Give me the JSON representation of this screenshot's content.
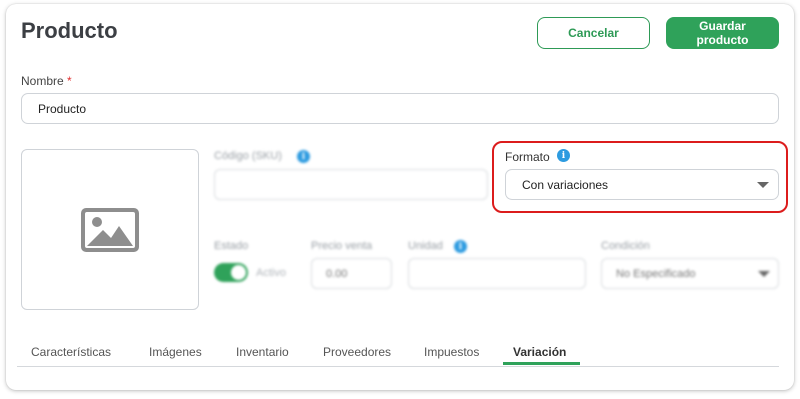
{
  "header": {
    "title": "Producto",
    "cancel_label": "Cancelar",
    "save_label": "Guardar producto"
  },
  "nombre": {
    "label": "Nombre",
    "required_mark": "*",
    "value": "Producto"
  },
  "sku": {
    "label": "Código (SKU)",
    "value": ""
  },
  "formato": {
    "label": "Formato",
    "value": "Con variaciones"
  },
  "estado": {
    "label": "Estado",
    "value": "Activo",
    "enabled": true
  },
  "precio": {
    "label": "Precio venta",
    "value": "0.00"
  },
  "unidad": {
    "label": "Unidad",
    "value": ""
  },
  "condicion": {
    "label": "Condición",
    "value": "No Especificado"
  },
  "tabs": [
    {
      "label": "Características"
    },
    {
      "label": "Imágenes"
    },
    {
      "label": "Inventario"
    },
    {
      "label": "Proveedores"
    },
    {
      "label": "Impuestos"
    },
    {
      "label": "Variación",
      "active": true
    }
  ],
  "colors": {
    "accent": "#2fa25a",
    "highlight": "#dc1c1c",
    "info": "#2d9be0"
  },
  "icons": {
    "image_placeholder": "image-icon",
    "info": "info-icon",
    "dropdown": "caret-down-icon"
  }
}
